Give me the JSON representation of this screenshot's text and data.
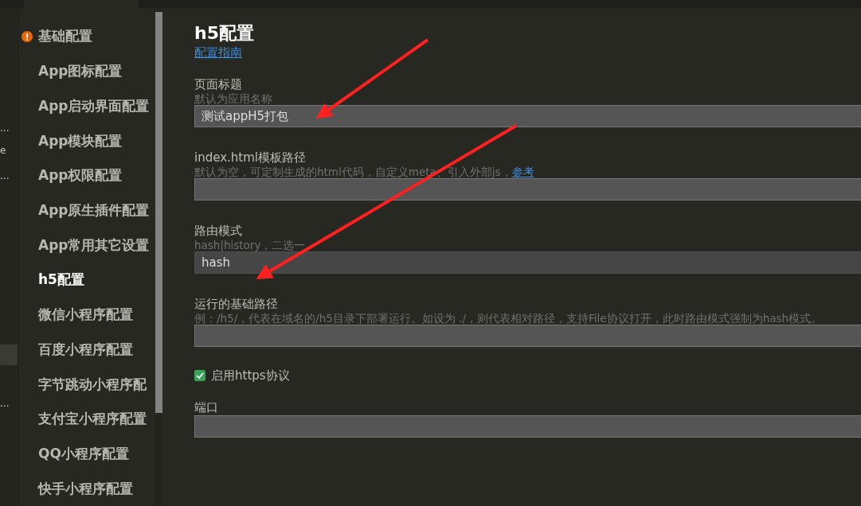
{
  "edge_panel": {
    "items": [
      {
        "text": "...",
        "selected": false
      },
      {
        "text": "e",
        "selected": false
      },
      {
        "text": "...",
        "selected": false
      },
      {
        "selected": true
      },
      {
        "text": "...",
        "selected": false
      }
    ]
  },
  "sidebar": {
    "items": [
      {
        "label": "基础配置",
        "warning": true,
        "selected": false
      },
      {
        "label": "App图标配置",
        "warning": false,
        "selected": false
      },
      {
        "label": "App启动界面配置",
        "warning": false,
        "selected": false
      },
      {
        "label": "App模块配置",
        "warning": false,
        "selected": false
      },
      {
        "label": "App权限配置",
        "warning": false,
        "selected": false
      },
      {
        "label": "App原生插件配置",
        "warning": false,
        "selected": false
      },
      {
        "label": "App常用其它设置",
        "warning": false,
        "selected": false
      },
      {
        "label": "h5配置",
        "warning": false,
        "selected": true
      },
      {
        "label": "微信小程序配置",
        "warning": false,
        "selected": false
      },
      {
        "label": "百度小程序配置",
        "warning": false,
        "selected": false
      },
      {
        "label": "字节跳动小程序配",
        "warning": false,
        "selected": false
      },
      {
        "label": "支付宝小程序配置",
        "warning": false,
        "selected": false
      },
      {
        "label": "QQ小程序配置",
        "warning": false,
        "selected": false
      },
      {
        "label": "快手小程序配置",
        "warning": false,
        "selected": false
      }
    ]
  },
  "main": {
    "title": "h5配置",
    "guide_link": "配置指南",
    "fields": [
      {
        "kind": "text",
        "label": "页面标题",
        "hint": "默认为应用名称",
        "value": "测试appH5打包"
      },
      {
        "kind": "text",
        "label": "index.html模板路径",
        "hint": "默认为空，可定制生成的html代码，自定义meta、引入外部js，",
        "hint_link": "参考"
      },
      {
        "kind": "select",
        "label": "路由模式",
        "hint": "hash|history，二选一",
        "value": "hash"
      },
      {
        "kind": "text",
        "label": "运行的基础路径",
        "hint": "例：/h5/，代表在域名的/h5目录下部署运行。如设为 ./，则代表相对路径，支持File协议打开，此时路由模式强制为hash模式。"
      },
      {
        "kind": "checkbox",
        "label": "启用https协议",
        "checked": true
      },
      {
        "kind": "text",
        "label": "端口"
      }
    ]
  }
}
